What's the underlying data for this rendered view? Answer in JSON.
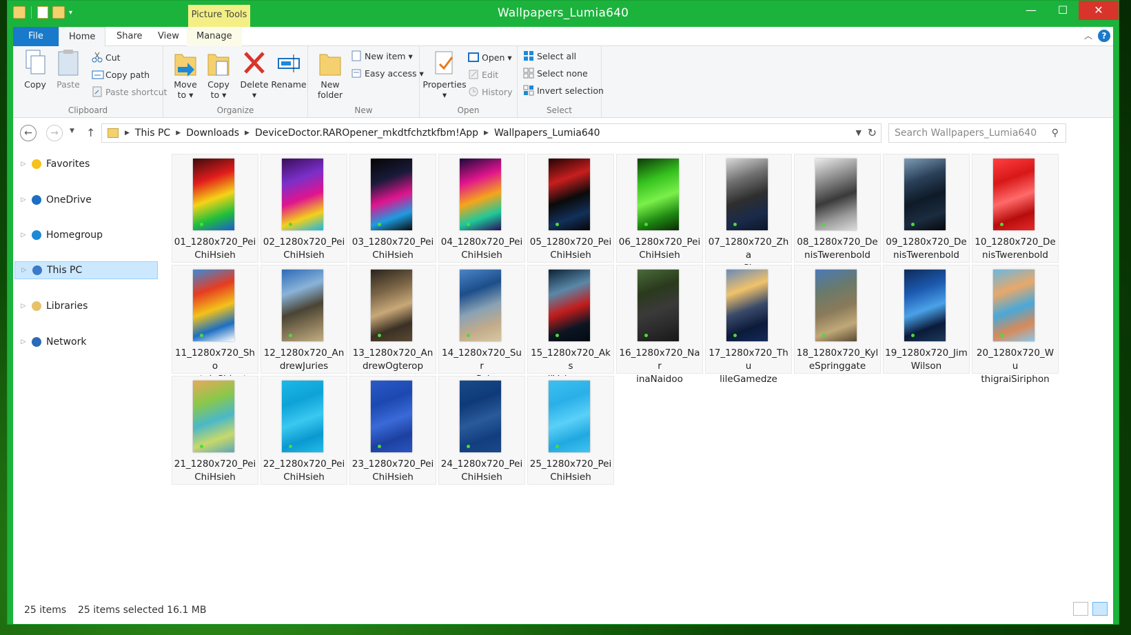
{
  "window": {
    "title": "Wallpapers_Lumia640",
    "context_tab": "Picture Tools",
    "controls": {
      "minimize": "—",
      "maximize": "☐",
      "close": "✕"
    }
  },
  "ribbon_tabs": {
    "file": "File",
    "home": "Home",
    "share": "Share",
    "view": "View",
    "manage": "Manage",
    "help": "?"
  },
  "ribbon": {
    "clipboard": {
      "label": "Clipboard",
      "copy": "Copy",
      "paste": "Paste",
      "cut": "Cut",
      "copy_path": "Copy path",
      "paste_shortcut": "Paste shortcut"
    },
    "organize": {
      "label": "Organize",
      "move_to_1": "Move",
      "move_to_2": "to ▾",
      "copy_to_1": "Copy",
      "copy_to_2": "to ▾",
      "delete": "Delete",
      "delete_drop": "▾",
      "rename": "Rename"
    },
    "new": {
      "label": "New",
      "new_folder_1": "New",
      "new_folder_2": "folder",
      "new_item": "New item ▾",
      "easy_access": "Easy access ▾"
    },
    "open": {
      "label": "Open",
      "properties": "Properties",
      "properties_drop": "▾",
      "open": "Open ▾",
      "edit": "Edit",
      "history": "History"
    },
    "select": {
      "label": "Select",
      "select_all": "Select all",
      "select_none": "Select none",
      "invert": "Invert selection"
    }
  },
  "address": {
    "crumbs": [
      "This PC",
      "Downloads",
      "DeviceDoctor.RAROpener_mkdtfchztkfbm!App",
      "Wallpapers_Lumia640"
    ],
    "search_placeholder": "Search Wallpapers_Lumia640"
  },
  "nav": {
    "items": [
      {
        "label": "Favorites",
        "icon": "star-icon"
      },
      {
        "label": "OneDrive",
        "icon": "cloud-icon"
      },
      {
        "label": "Homegroup",
        "icon": "homegroup-icon"
      },
      {
        "label": "This PC",
        "icon": "computer-icon",
        "selected": true
      },
      {
        "label": "Libraries",
        "icon": "library-icon"
      },
      {
        "label": "Network",
        "icon": "network-icon"
      }
    ]
  },
  "files": [
    {
      "l1": "01_1280x720_Pei",
      "l2": "ChiHsieh",
      "colors": [
        "#3b0c0c",
        "#e21c1c",
        "#f5d316",
        "#1fbf3a",
        "#1c5ad1"
      ]
    },
    {
      "l1": "02_1280x720_Pei",
      "l2": "ChiHsieh",
      "colors": [
        "#3a0e5a",
        "#7b2fc9",
        "#e0148e",
        "#f3d01b",
        "#18b7e8"
      ]
    },
    {
      "l1": "03_1280x720_Pei",
      "l2": "ChiHsieh",
      "colors": [
        "#050505",
        "#1a1a3a",
        "#e0148e",
        "#1e9be0",
        "#0a0a0a"
      ]
    },
    {
      "l1": "04_1280x720_Pei",
      "l2": "ChiHsieh",
      "colors": [
        "#1a0a3a",
        "#e0148e",
        "#f5a51b",
        "#1fc79a",
        "#2a0e5a"
      ]
    },
    {
      "l1": "05_1280x720_Pei",
      "l2": "ChiHsieh",
      "colors": [
        "#220404",
        "#c81e1e",
        "#0a0a0a",
        "#12305a",
        "#050505"
      ]
    },
    {
      "l1": "06_1280x720_Pei",
      "l2": "ChiHsieh",
      "colors": [
        "#0d3a0a",
        "#36c21e",
        "#7af04a",
        "#1f8a12",
        "#0a2a06"
      ]
    },
    {
      "l1": "07_1280x720_Zha",
      "l2": "ngChao",
      "colors": [
        "#d8d8d8",
        "#6d6d6d",
        "#2e2e2e",
        "#1a2a4a",
        "#0c1628"
      ]
    },
    {
      "l1": "08_1280x720_De",
      "l2": "nisTwerenbold",
      "colors": [
        "#ececec",
        "#8a8a8a",
        "#3a3a3a",
        "#9a9a9a",
        "#dcdcdc"
      ]
    },
    {
      "l1": "09_1280x720_De",
      "l2": "nisTwerenbold",
      "colors": [
        "#7d9bb5",
        "#2a4058",
        "#0e1a28",
        "#1b2c3f",
        "#05080c"
      ]
    },
    {
      "l1": "10_1280x720_De",
      "l2": "nisTwerenbold",
      "colors": [
        "#ff4040",
        "#d81818",
        "#ff6a6a",
        "#b80c0c",
        "#e42a2a"
      ]
    },
    {
      "l1": "11_1280x720_Sho",
      "l2": "mwatalaShivute",
      "colors": [
        "#3a8ad8",
        "#e63c22",
        "#f3c21a",
        "#1c6fc2",
        "#ffffff"
      ]
    },
    {
      "l1": "12_1280x720_An",
      "l2": "drewJuries",
      "colors": [
        "#2c6ab8",
        "#8ab3d8",
        "#4a4434",
        "#8a7a5a",
        "#c2ae82"
      ]
    },
    {
      "l1": "13_1280x720_An",
      "l2": "drewOgterop",
      "colors": [
        "#2a241c",
        "#7a6446",
        "#c8a878",
        "#3a3024",
        "#5a4a34"
      ]
    },
    {
      "l1": "14_1280x720_Sur",
      "l2": "ayaPelser",
      "colors": [
        "#4a84c8",
        "#1c4e8a",
        "#8aa2b4",
        "#c2ab8a",
        "#d8c8a4"
      ]
    },
    {
      "l1": "15_1280x720_Aks",
      "l2": "eliValmunen",
      "colors": [
        "#0c2236",
        "#5a88a8",
        "#c21c1c",
        "#0a1622",
        "#050a10"
      ]
    },
    {
      "l1": "16_1280x720_Nar",
      "l2": "inaNaidoo",
      "colors": [
        "#4a6a3a",
        "#2a3a1c",
        "#3a3a3a",
        "#2a2a2a",
        "#181818"
      ]
    },
    {
      "l1": "17_1280x720_Thu",
      "l2": "lileGamedze",
      "colors": [
        "#6a8ab8",
        "#f0c26a",
        "#3a4a6a",
        "#0c1a3a",
        "#142a5a"
      ]
    },
    {
      "l1": "18_1280x720_Kyl",
      "l2": "eSpringgate",
      "colors": [
        "#4a7ab8",
        "#6a7a6a",
        "#8a7a5a",
        "#c0a878",
        "#5a4a34"
      ]
    },
    {
      "l1": "19_1280x720_Jim",
      "l2": "Wilson",
      "colors": [
        "#0e2a5a",
        "#1c5ab0",
        "#4aa2e8",
        "#0a1a3a",
        "#1c3a5a"
      ]
    },
    {
      "l1": "20_1280x720_Wu",
      "l2": "thigraiSiriphon",
      "colors": [
        "#6ab8e0",
        "#e8a86a",
        "#4aa8d8",
        "#d88a5a",
        "#8ac8e8"
      ]
    },
    {
      "l1": "21_1280x720_Pei",
      "l2": "ChiHsieh",
      "colors": [
        "#e8a85a",
        "#8ac84a",
        "#4ab8c8",
        "#c8d86a",
        "#5aa8b8"
      ]
    },
    {
      "l1": "22_1280x720_Pei",
      "l2": "ChiHsieh",
      "colors": [
        "#1cb8e8",
        "#0ea2d8",
        "#3ac8f0",
        "#0a98d0",
        "#22bde8"
      ]
    },
    {
      "l1": "23_1280x720_Pei",
      "l2": "ChiHsieh",
      "colors": [
        "#2a5ac8",
        "#1c48b0",
        "#3a6ad8",
        "#1c40a0",
        "#2a56c0"
      ]
    },
    {
      "l1": "24_1280x720_Pei",
      "l2": "ChiHsieh",
      "colors": [
        "#1a4a8a",
        "#0e3a78",
        "#2a5a9a",
        "#123e80",
        "#1a4888"
      ]
    },
    {
      "l1": "25_1280x720_Pei",
      "l2": "ChiHsieh",
      "colors": [
        "#3ac0f0",
        "#2ab0e8",
        "#5ad0f8",
        "#20a8e0",
        "#40c4f2"
      ]
    }
  ],
  "status": {
    "count": "25 items",
    "selection": "25 items selected  16.1 MB"
  }
}
